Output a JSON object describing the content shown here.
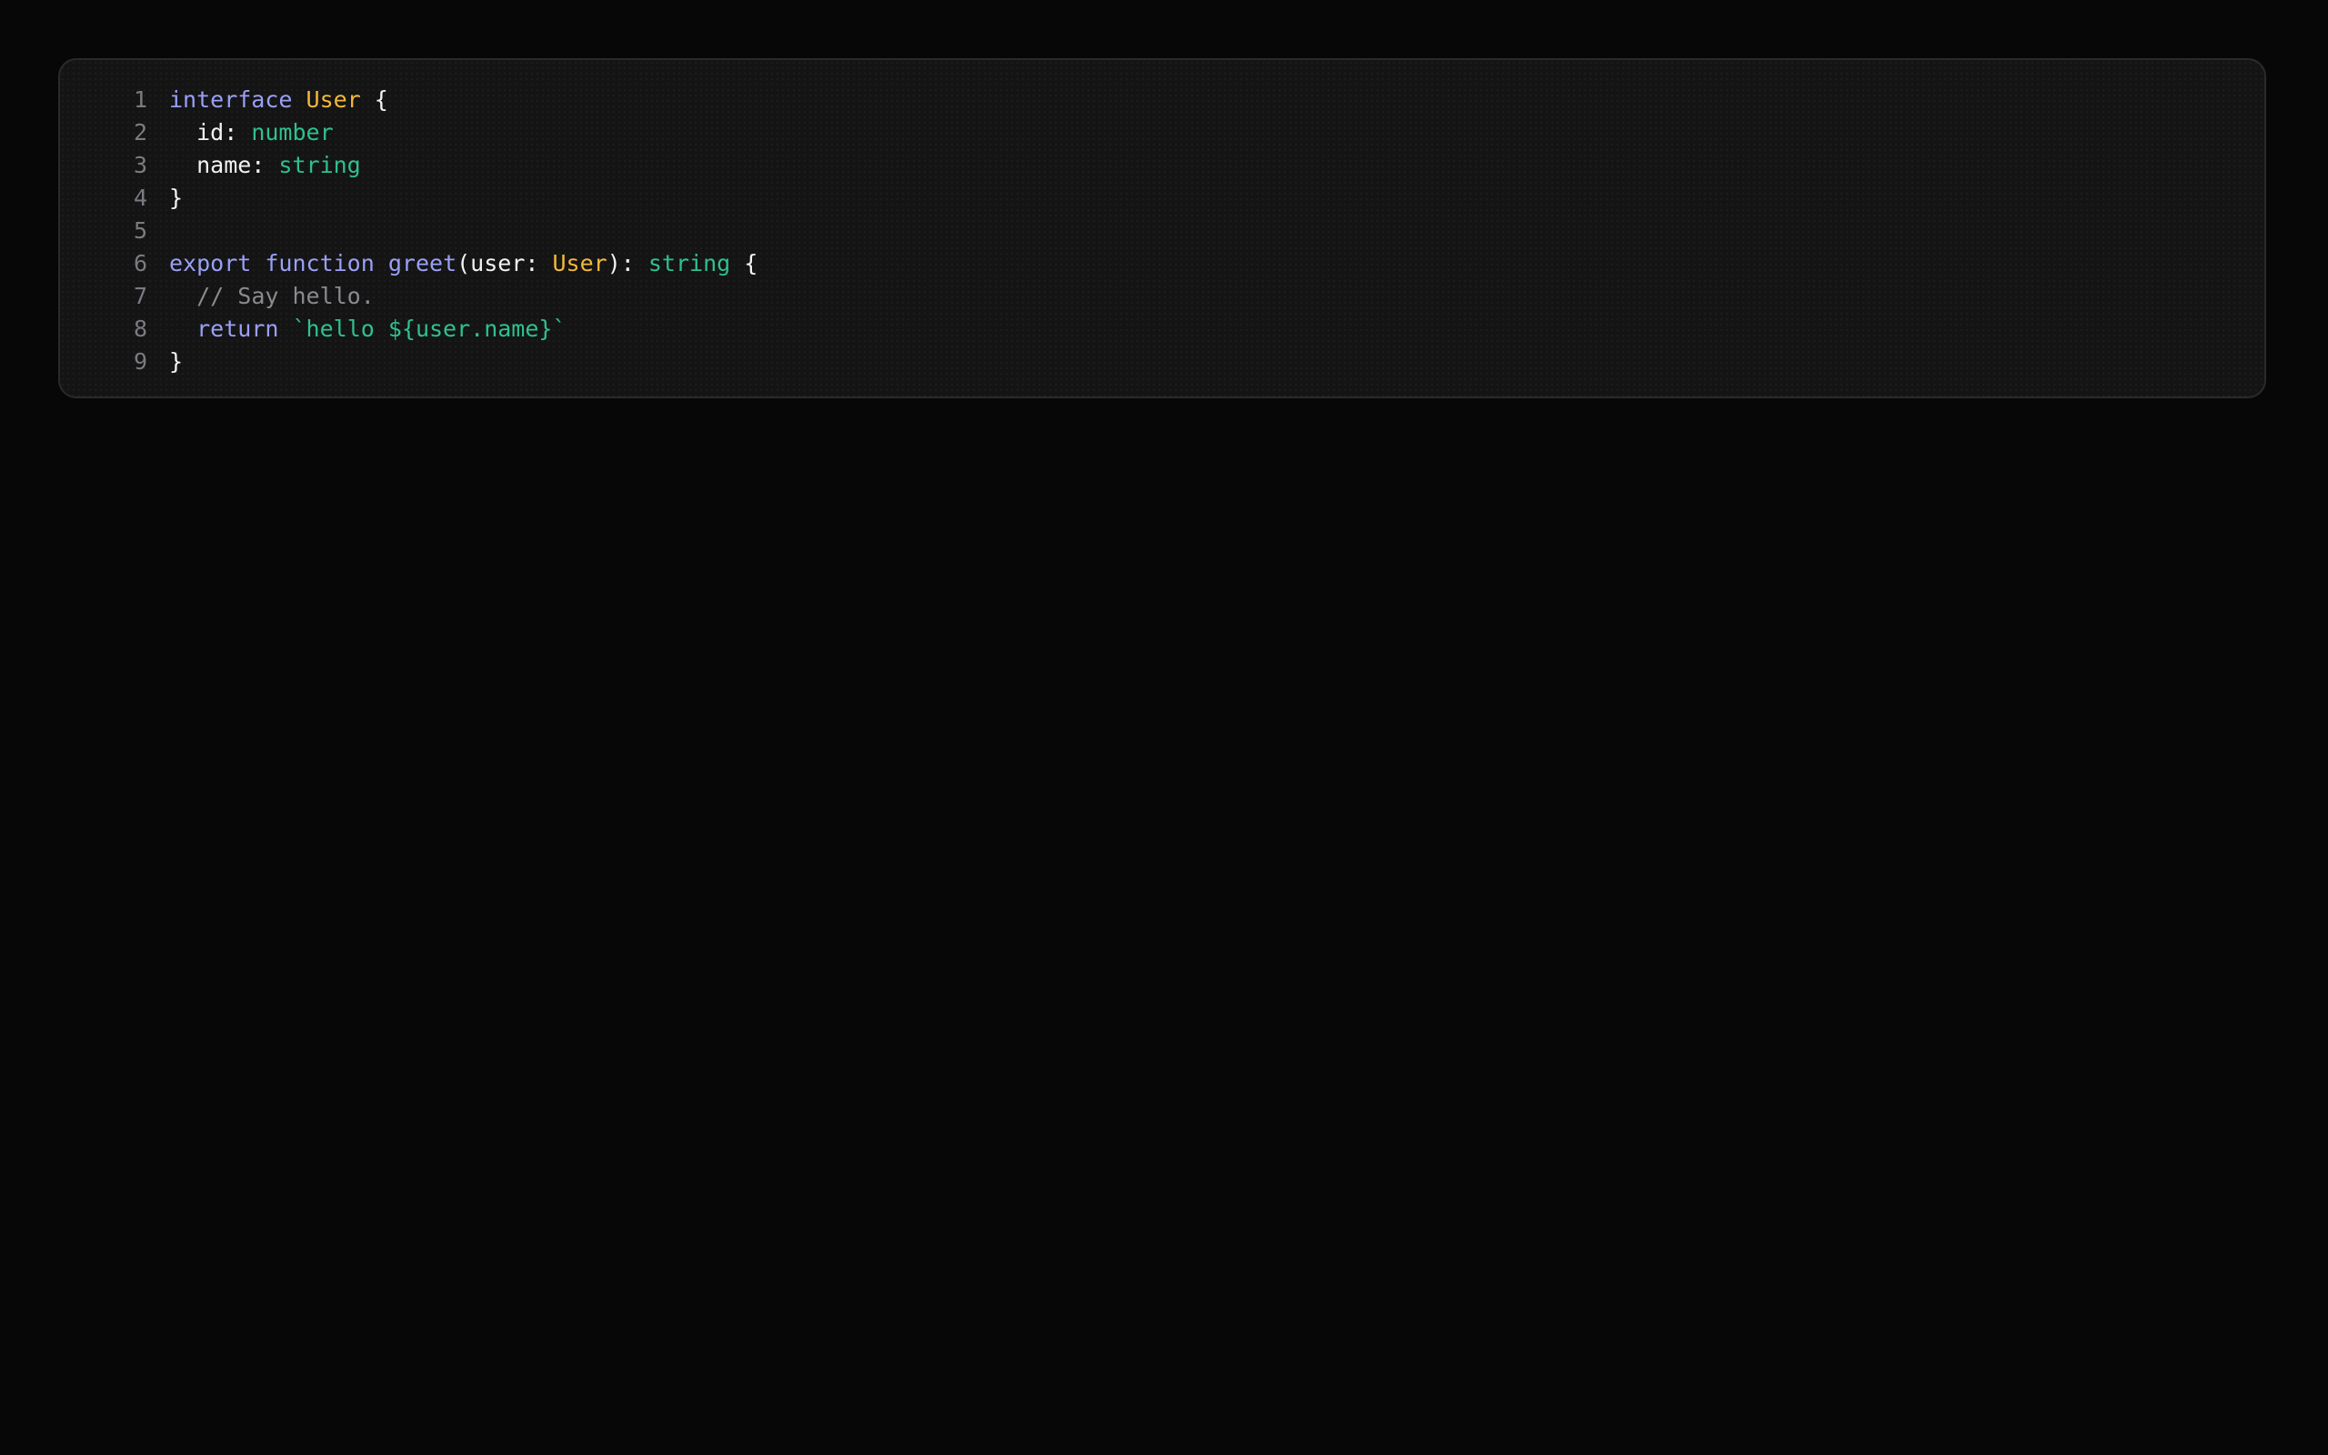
{
  "colors": {
    "background": "#070707",
    "card_background": "#141415",
    "card_border": "#2a2a2c",
    "line_number": "#7b7b80",
    "keyword": "#9aa0f5",
    "type": "#f2b83a",
    "primitive": "#2fc08f",
    "string": "#2fc08f",
    "comment": "#8a8a8f",
    "plain": "#f2f2f2"
  },
  "code_block": {
    "language": "typescript",
    "lines": [
      {
        "number": "1",
        "tokens": [
          {
            "kind": "keyword",
            "text": "interface"
          },
          {
            "kind": "plain",
            "text": " "
          },
          {
            "kind": "type",
            "text": "User"
          },
          {
            "kind": "plain",
            "text": " {"
          }
        ]
      },
      {
        "number": "2",
        "tokens": [
          {
            "kind": "plain",
            "text": "  id: "
          },
          {
            "kind": "prim",
            "text": "number"
          }
        ]
      },
      {
        "number": "3",
        "tokens": [
          {
            "kind": "plain",
            "text": "  name: "
          },
          {
            "kind": "prim",
            "text": "string"
          }
        ]
      },
      {
        "number": "4",
        "tokens": [
          {
            "kind": "plain",
            "text": "}"
          }
        ]
      },
      {
        "number": "5",
        "tokens": []
      },
      {
        "number": "6",
        "tokens": [
          {
            "kind": "keyword",
            "text": "export"
          },
          {
            "kind": "plain",
            "text": " "
          },
          {
            "kind": "keyword",
            "text": "function"
          },
          {
            "kind": "plain",
            "text": " "
          },
          {
            "kind": "keyword",
            "text": "greet"
          },
          {
            "kind": "plain",
            "text": "(user: "
          },
          {
            "kind": "type",
            "text": "User"
          },
          {
            "kind": "plain",
            "text": "): "
          },
          {
            "kind": "prim",
            "text": "string"
          },
          {
            "kind": "plain",
            "text": " {"
          }
        ]
      },
      {
        "number": "7",
        "tokens": [
          {
            "kind": "plain",
            "text": "  "
          },
          {
            "kind": "comment",
            "text": "// Say hello."
          }
        ]
      },
      {
        "number": "8",
        "tokens": [
          {
            "kind": "plain",
            "text": "  "
          },
          {
            "kind": "keyword",
            "text": "return"
          },
          {
            "kind": "plain",
            "text": " "
          },
          {
            "kind": "string",
            "text": "`hello ${user.name}`"
          }
        ]
      },
      {
        "number": "9",
        "tokens": [
          {
            "kind": "plain",
            "text": "}"
          }
        ]
      }
    ]
  }
}
